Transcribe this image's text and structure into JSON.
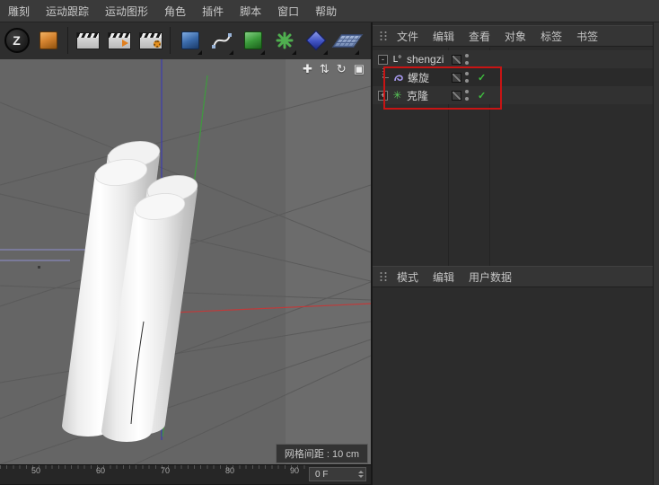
{
  "menubar": {
    "items": [
      "雕刻",
      "运动跟踪",
      "运动图形",
      "角色",
      "插件",
      "脚本",
      "窗口",
      "帮助"
    ]
  },
  "toolbar": {
    "icons": [
      {
        "name": "app-logo-icon",
        "glyph": "Z"
      },
      {
        "name": "model-tool-icon"
      },
      {
        "name": "render-view-icon"
      },
      {
        "name": "render-picture-viewer-icon"
      },
      {
        "name": "render-settings-icon"
      },
      {
        "name": "primitive-cube-icon"
      },
      {
        "name": "spline-pen-icon"
      },
      {
        "name": "generator-icon"
      },
      {
        "name": "deformer-icon"
      },
      {
        "name": "environment-icon"
      },
      {
        "name": "floor-icon"
      }
    ]
  },
  "viewport": {
    "nav_icons": [
      {
        "name": "pan-view-icon",
        "glyph": "✚"
      },
      {
        "name": "zoom-view-icon",
        "glyph": "⇅"
      },
      {
        "name": "rotate-view-icon",
        "glyph": "↻"
      },
      {
        "name": "toggle-view-icon",
        "glyph": "▣"
      }
    ],
    "grid_label": "网格间距 : 10 cm",
    "ruler_ticks": [
      "50",
      "60",
      "70",
      "80",
      "90"
    ],
    "frame_value": "0 F"
  },
  "object_manager": {
    "menu": [
      "文件",
      "编辑",
      "查看",
      "对象",
      "标签",
      "书签"
    ],
    "tree": [
      {
        "label": "shengzi",
        "icon": "null-object-icon",
        "icon_glyph": "L°",
        "expander": "-"
      },
      {
        "label": "螺旋",
        "icon": "helix-spline-icon",
        "enabled": "✓"
      },
      {
        "label": "克隆",
        "icon": "cloner-icon",
        "icon_glyph": "✳",
        "expander": "+",
        "enabled": "✓"
      }
    ]
  },
  "attribute_manager": {
    "menu": [
      "模式",
      "编辑",
      "用户数据"
    ]
  },
  "colors": {
    "highlight_red": "#c81414",
    "check_green": "#3fbf3f",
    "axis_blue": "#3b3bb0",
    "axis_green": "#3f9a3f",
    "axis_red": "#c03a3a",
    "viewport_gray": "#656565"
  }
}
